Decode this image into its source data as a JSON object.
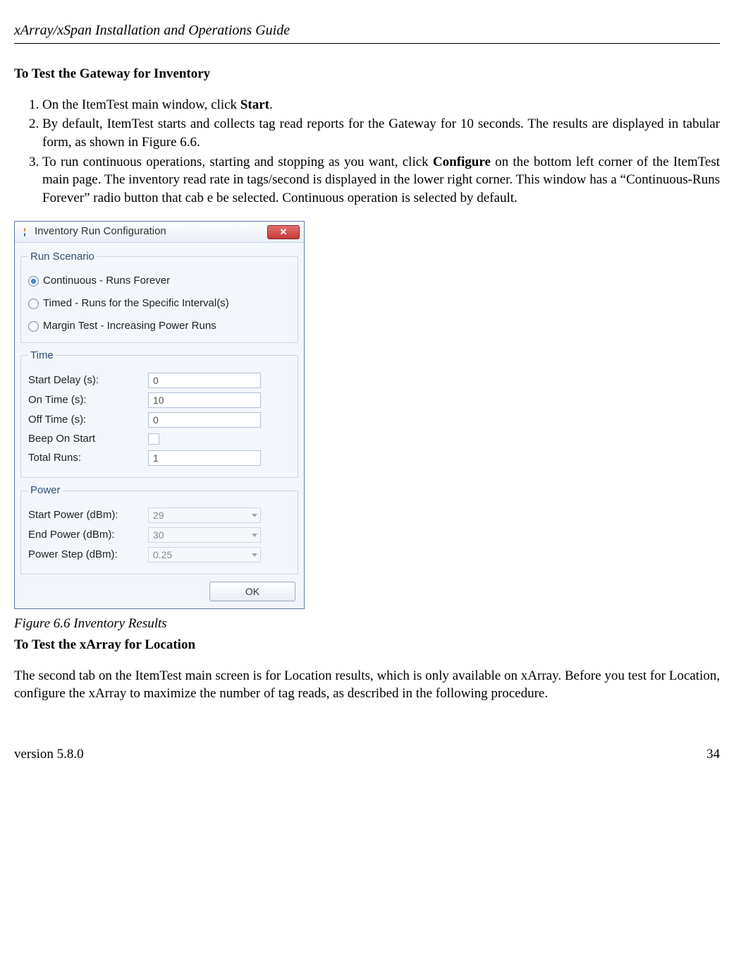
{
  "header": {
    "doc_title": "xArray/xSpan Installation and Operations Guide"
  },
  "section1": {
    "heading": "To Test the Gateway for Inventory",
    "steps": [
      {
        "pre": "On the ItemTest main window, click ",
        "bold": "Start",
        "post": "."
      },
      {
        "pre": "By default, ItemTest starts and collects tag read reports for the Gateway for 10 seconds. The results are displayed in tabular form, as shown in Figure 6.6.",
        "bold": "",
        "post": ""
      },
      {
        "pre": "To run continuous operations, starting and stopping as you want, click ",
        "bold": "Configure",
        "post": " on the bottom left corner of the ItemTest main page. The inventory read rate in tags/second is displayed in the lower right corner. This window has a “Continuous-Runs Forever” radio button that cab e be selected. Continuous operation is selected by default."
      }
    ]
  },
  "dialog": {
    "title": "Inventory Run Configuration",
    "groups": {
      "run_scenario": {
        "legend": "Run Scenario",
        "options": [
          "Continuous - Runs Forever",
          "Timed - Runs for the Specific Interval(s)",
          "Margin Test - Increasing Power Runs"
        ],
        "selected_index": 0
      },
      "time": {
        "legend": "Time",
        "start_delay": {
          "label": "Start Delay (s):",
          "value": "0"
        },
        "on_time": {
          "label": "On Time (s):",
          "value": "10"
        },
        "off_time": {
          "label": "Off Time (s):",
          "value": "0"
        },
        "beep": {
          "label": "Beep On Start"
        },
        "total_runs": {
          "label": "Total Runs:",
          "value": "1"
        }
      },
      "power": {
        "legend": "Power",
        "start_power": {
          "label": "Start Power (dBm):",
          "value": "29"
        },
        "end_power": {
          "label": "End Power (dBm):",
          "value": "30"
        },
        "power_step": {
          "label": "Power Step (dBm):",
          "value": "0.25"
        }
      }
    },
    "ok_label": "OK"
  },
  "figure_caption": "Figure 6.6 Inventory Results",
  "section2": {
    "heading": "To Test the xArray for Location",
    "para": "The second tab on the ItemTest main screen is for Location results, which is only available on xArray. Before you test for Location, configure the xArray to maximize the number of tag reads, as described in the following procedure."
  },
  "footer": {
    "version": "version 5.8.0",
    "page": "34"
  }
}
